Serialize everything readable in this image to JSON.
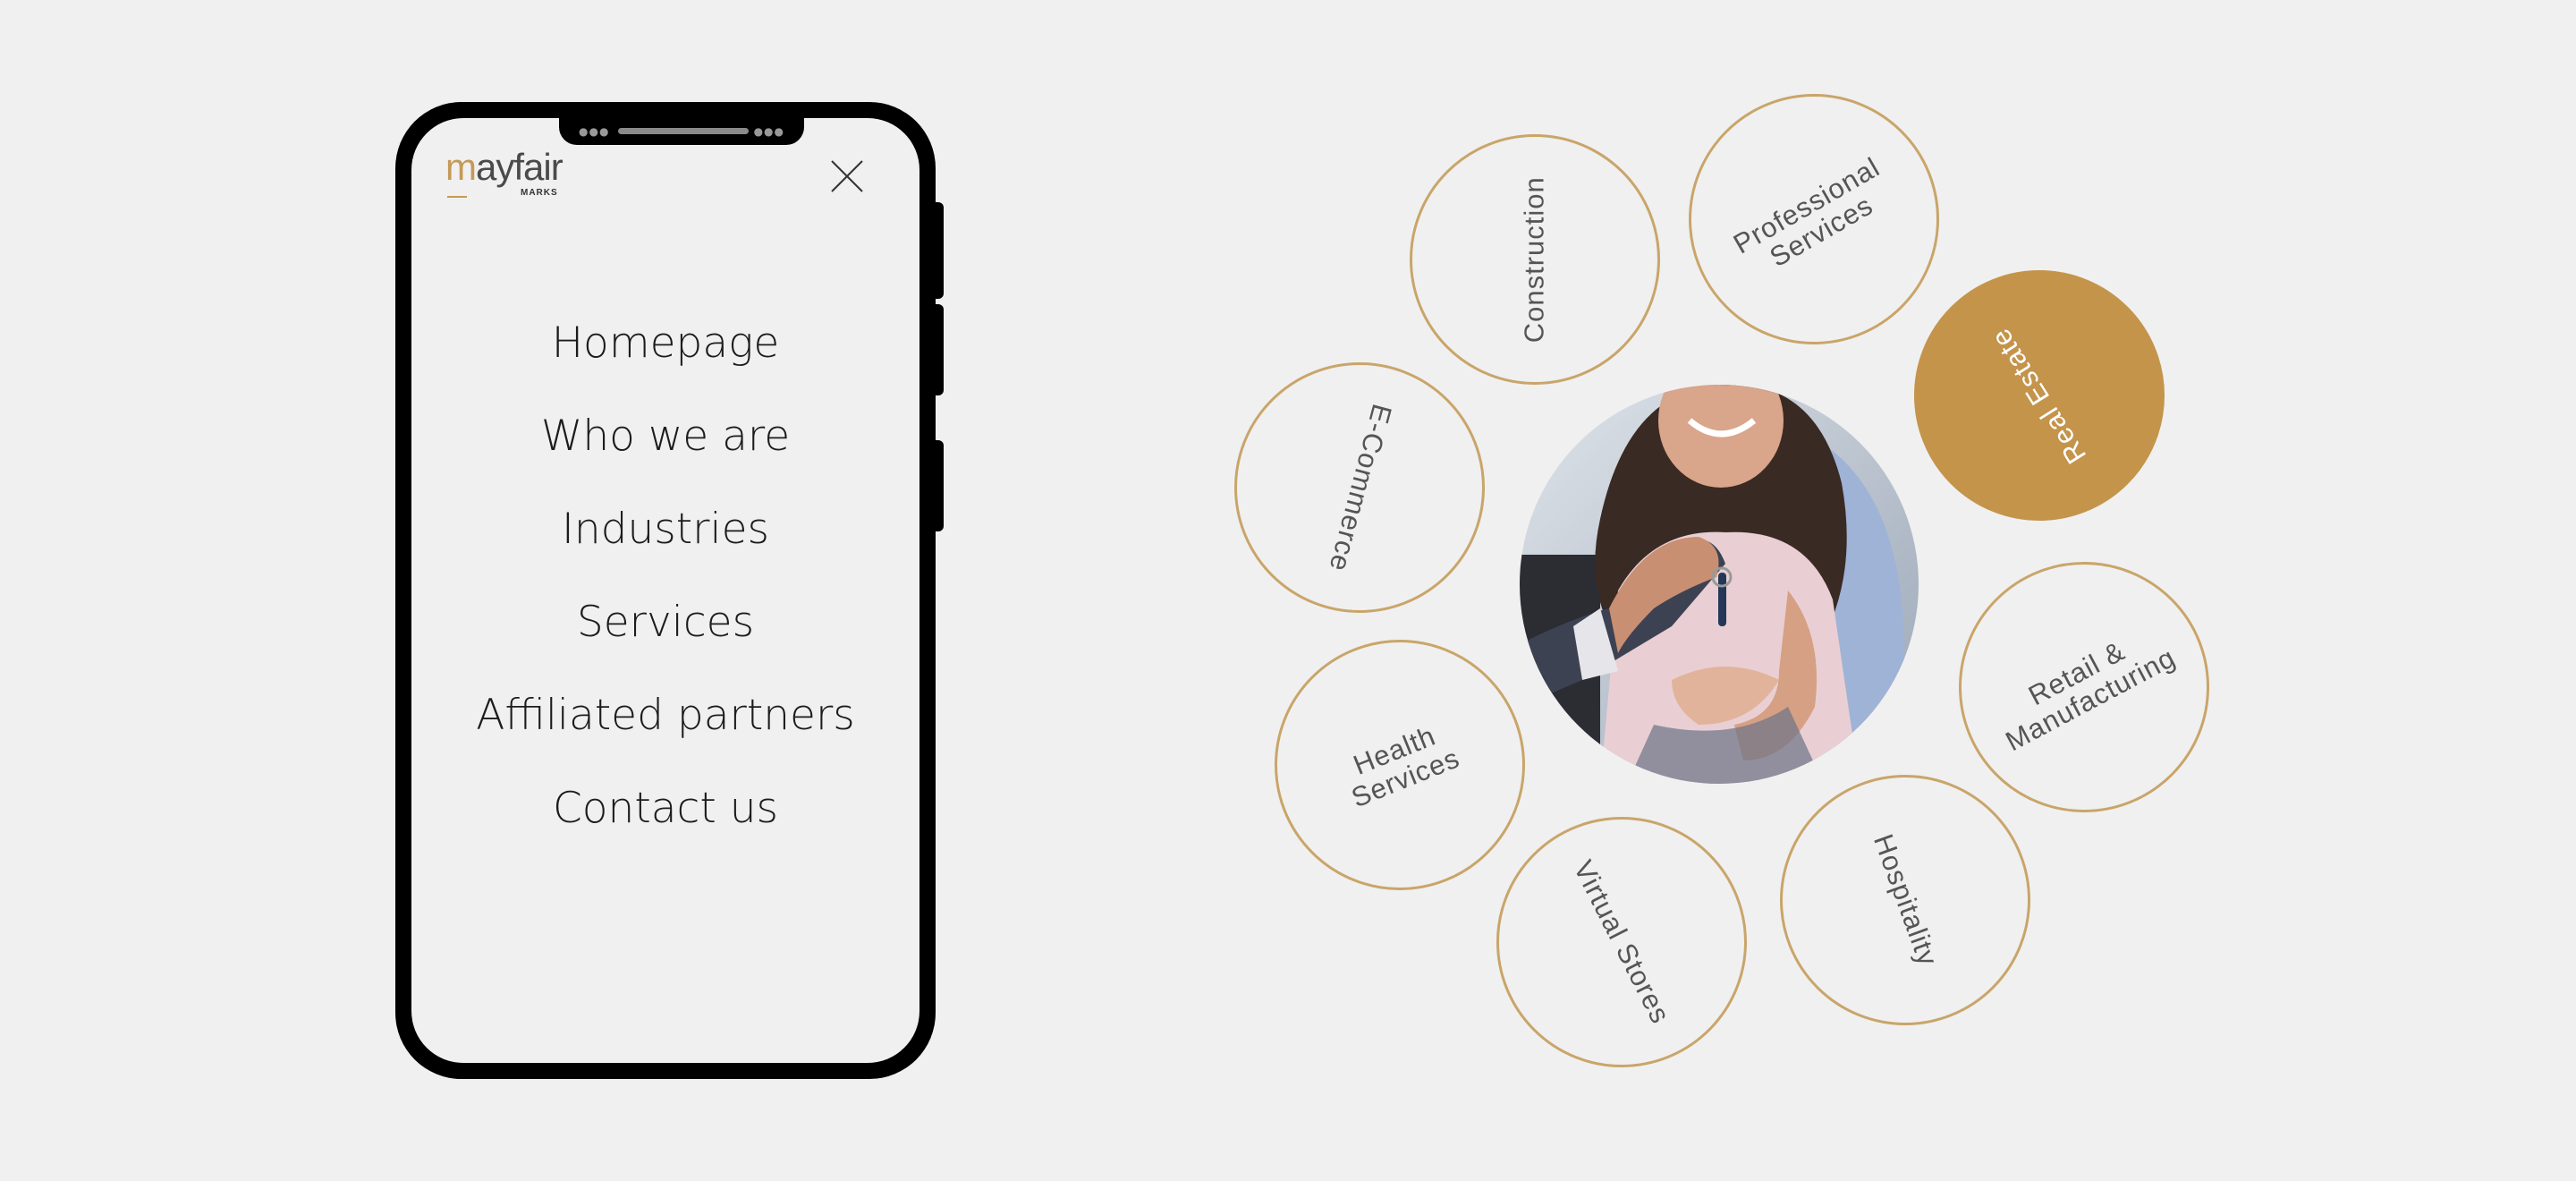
{
  "logo": {
    "word_accent": "m",
    "word_rest": "ayfair",
    "subtitle": "MARKS"
  },
  "colors": {
    "accent": "#c4944b",
    "ring": "#c9a56a",
    "background": "#f0f0f0",
    "text": "#1c1c1c"
  },
  "icons": {
    "close": "close-icon"
  },
  "menu": {
    "items": [
      {
        "label": "Homepage"
      },
      {
        "label": "Who we are"
      },
      {
        "label": "Industries"
      },
      {
        "label": "Services"
      },
      {
        "label": "Affiliated partners"
      },
      {
        "label": "Contact us"
      }
    ]
  },
  "industries": {
    "active": "Real Estate",
    "items": [
      {
        "label": "Construction"
      },
      {
        "label": "Professional\nServices"
      },
      {
        "label": "Real Estate"
      },
      {
        "label": "E-Commerce"
      },
      {
        "label": "Retail &\nManufacturing"
      },
      {
        "label": "Health\nServices"
      },
      {
        "label": "Hospitality"
      },
      {
        "label": "Virtual Stores"
      }
    ]
  }
}
